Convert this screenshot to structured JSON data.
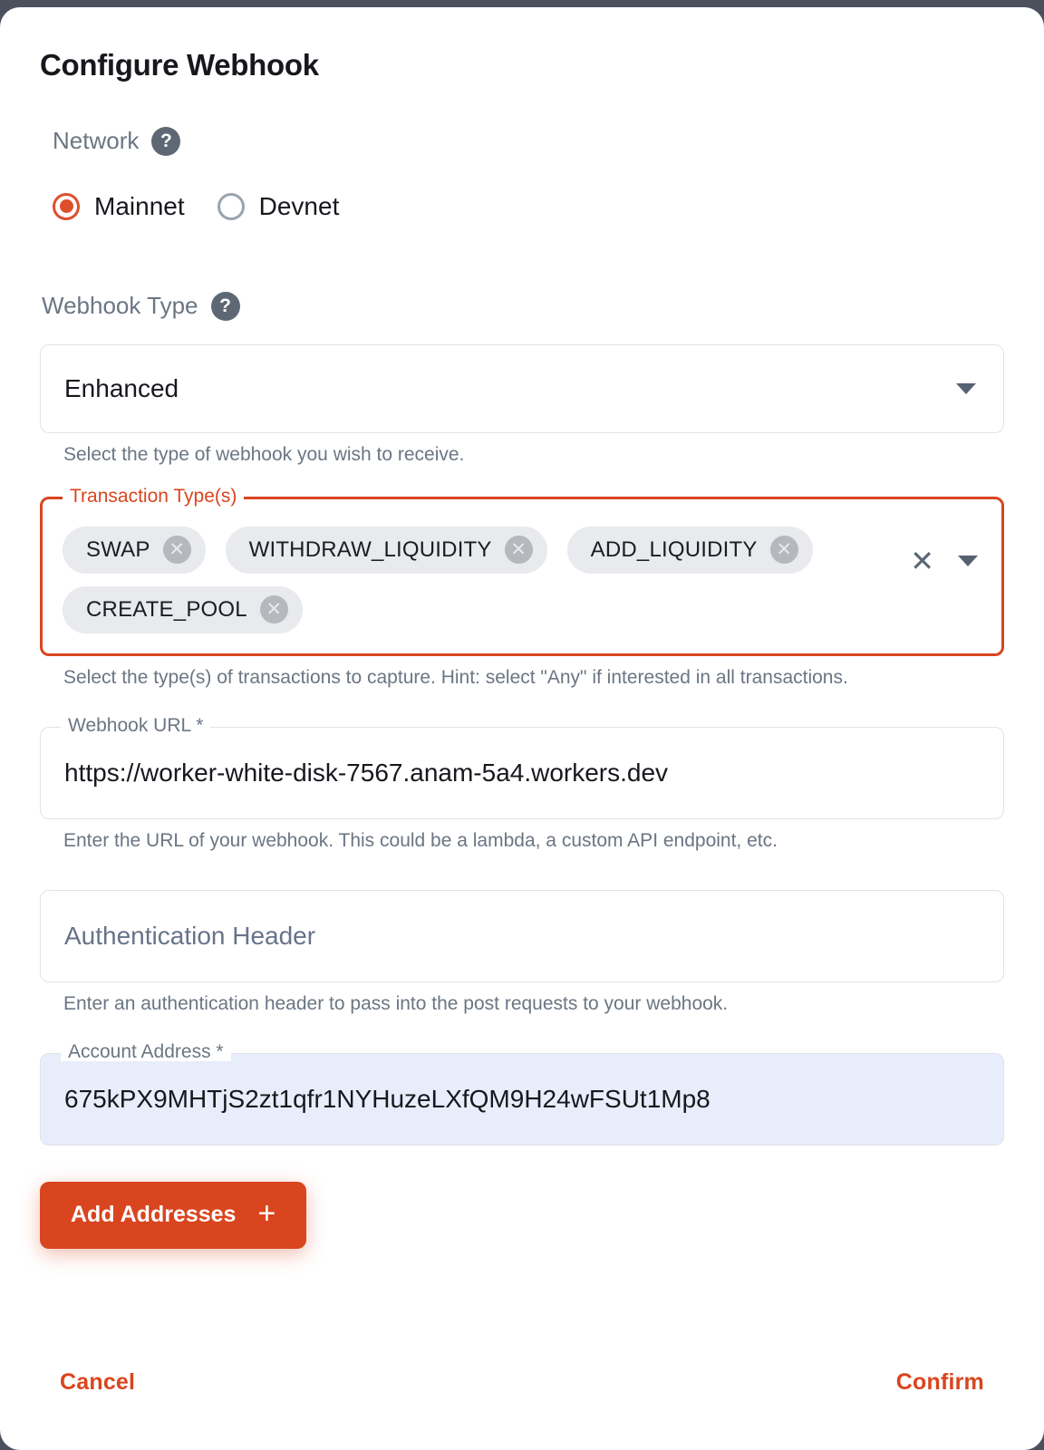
{
  "dialog": {
    "title": "Configure Webhook"
  },
  "network": {
    "label": "Network",
    "help_icon": "help-circle-icon",
    "options": [
      {
        "label": "Mainnet",
        "selected": true
      },
      {
        "label": "Devnet",
        "selected": false
      }
    ]
  },
  "webhook_type": {
    "label": "Webhook Type",
    "help_icon": "help-circle-icon",
    "value": "Enhanced",
    "caret_icon": "chevron-down-icon",
    "helper": "Select the type of webhook you wish to receive."
  },
  "transaction_types": {
    "legend": "Transaction Type(s)",
    "chips": [
      {
        "label": "SWAP",
        "remove_icon": "close-circle-icon"
      },
      {
        "label": "WITHDRAW_LIQUIDITY",
        "remove_icon": "close-circle-icon"
      },
      {
        "label": "ADD_LIQUIDITY",
        "remove_icon": "close-circle-icon"
      },
      {
        "label": "CREATE_POOL",
        "remove_icon": "close-circle-icon"
      }
    ],
    "clear_icon": "close-icon",
    "clear_glyph": "✕",
    "caret_icon": "chevron-down-icon",
    "helper": "Select the type(s) of transactions to capture. Hint: select \"Any\" if interested in all transactions."
  },
  "webhook_url": {
    "legend": "Webhook URL *",
    "value": "https://worker-white-disk-7567.anam-5a4.workers.dev",
    "helper": "Enter the URL of your webhook. This could be a lambda, a custom API endpoint, etc."
  },
  "auth_header": {
    "placeholder": "Authentication Header",
    "value": "",
    "helper": "Enter an authentication header to pass into the post requests to your webhook."
  },
  "account_address": {
    "legend": "Account Address *",
    "value": "675kPX9MHTjS2zt1qfr1NYHuzeLXfQM9H24wFSUt1Mp8"
  },
  "add_addresses": {
    "label": "Add Addresses",
    "icon": "plus-icon",
    "glyph": "+"
  },
  "footer": {
    "cancel_label": "Cancel",
    "confirm_label": "Confirm"
  },
  "colors": {
    "accent": "#d9451f",
    "radio_selected": "#df4e2b",
    "muted_text": "#6b7684",
    "backdrop": "#4b515c",
    "address_field_bg": "#e8edfb"
  }
}
